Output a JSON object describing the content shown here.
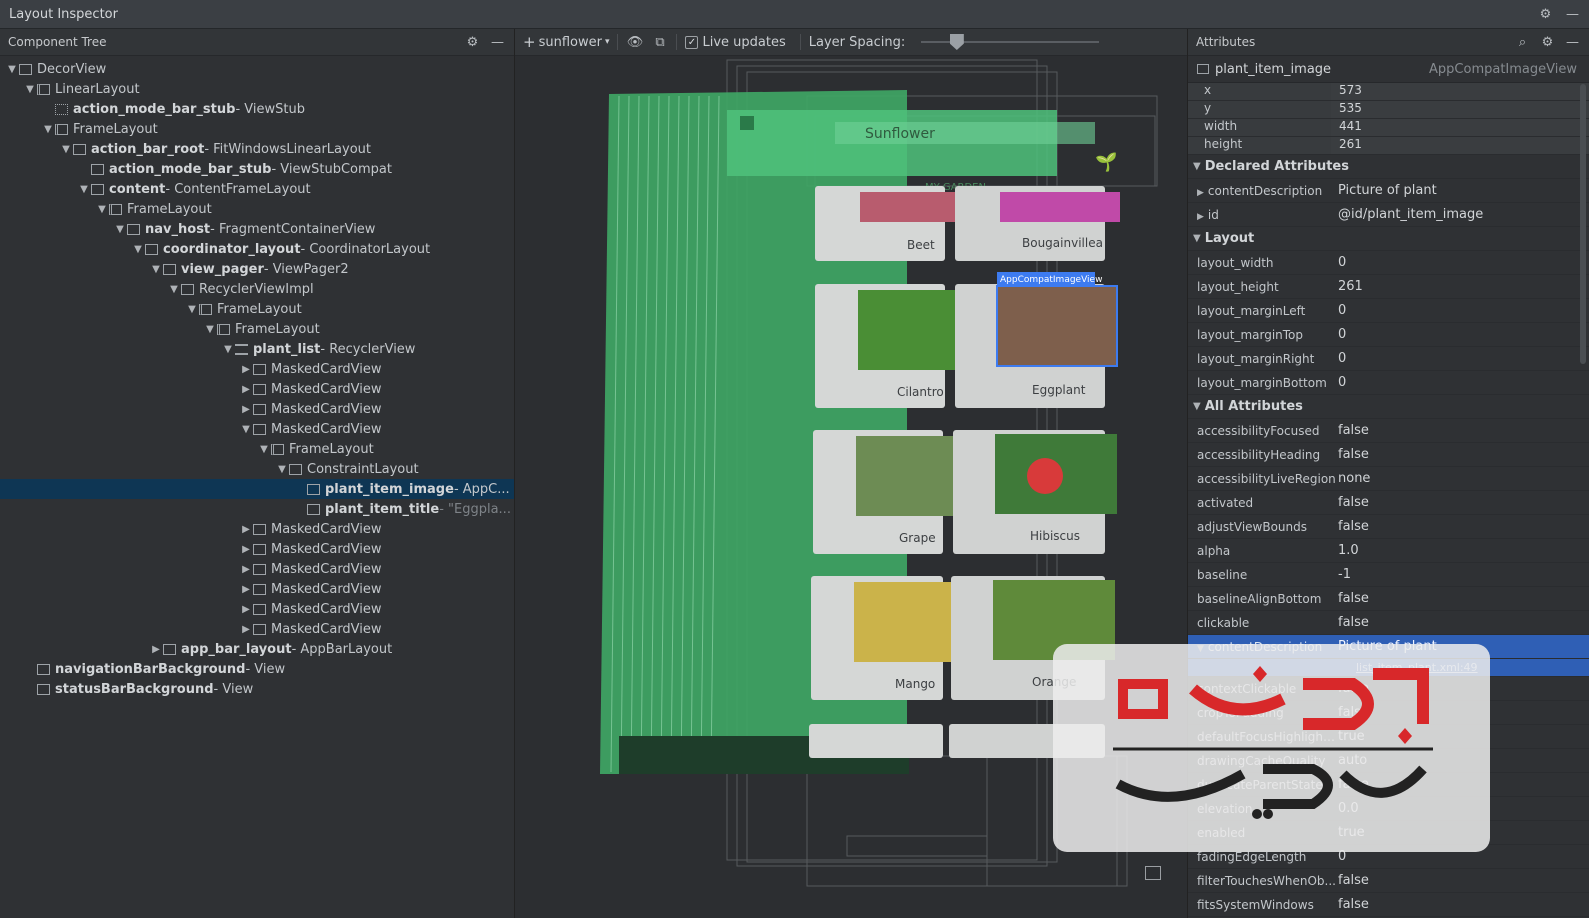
{
  "window": {
    "title": "Layout Inspector"
  },
  "tree_panel": {
    "title": "Component Tree"
  },
  "tree": [
    {
      "arrow": "▼",
      "icon": "window",
      "name": "DecorView",
      "cls": "",
      "bold": false
    },
    {
      "arrow": "▼",
      "icon": "linear",
      "name": "LinearLayout",
      "cls": "",
      "bold": false
    },
    {
      "arrow": "",
      "icon": "stub",
      "name": "action_mode_bar_stub",
      "cls": " - ViewStub",
      "bold": true
    },
    {
      "arrow": "▼",
      "icon": "frame",
      "name": "FrameLayout",
      "cls": "",
      "bold": false
    },
    {
      "arrow": "▼",
      "icon": "window",
      "name": "action_bar_root",
      "cls": " - FitWindowsLinearLayout",
      "bold": true
    },
    {
      "arrow": "",
      "icon": "window",
      "name": "action_mode_bar_stub",
      "cls": " - ViewStubCompat",
      "bold": true
    },
    {
      "arrow": "▼",
      "icon": "window",
      "name": "content",
      "cls": " - ContentFrameLayout",
      "bold": true
    },
    {
      "arrow": "▼",
      "icon": "frame",
      "name": "FrameLayout",
      "cls": "",
      "bold": false
    },
    {
      "arrow": "▼",
      "icon": "window",
      "name": "nav_host",
      "cls": " - FragmentContainerView",
      "bold": true
    },
    {
      "arrow": "▼",
      "icon": "coord",
      "name": "coordinator_layout",
      "cls": " - CoordinatorLayout",
      "bold": true
    },
    {
      "arrow": "▼",
      "icon": "window",
      "name": "view_pager",
      "cls": " - ViewPager2",
      "bold": true
    },
    {
      "arrow": "▼",
      "icon": "window",
      "name": "RecyclerViewImpl",
      "cls": "",
      "bold": false
    },
    {
      "arrow": "▼",
      "icon": "frame",
      "name": "FrameLayout",
      "cls": "",
      "bold": false
    },
    {
      "arrow": "▼",
      "icon": "frame",
      "name": "FrameLayout",
      "cls": "",
      "bold": false
    },
    {
      "arrow": "▼",
      "icon": "list",
      "name": "plant_list",
      "cls": " - RecyclerView",
      "bold": true
    },
    {
      "arrow": "▶",
      "icon": "window",
      "name": "MaskedCardView",
      "cls": "",
      "bold": false
    },
    {
      "arrow": "▶",
      "icon": "window",
      "name": "MaskedCardView",
      "cls": "",
      "bold": false
    },
    {
      "arrow": "▶",
      "icon": "window",
      "name": "MaskedCardView",
      "cls": "",
      "bold": false
    },
    {
      "arrow": "▼",
      "icon": "window",
      "name": "MaskedCardView",
      "cls": "",
      "bold": false
    },
    {
      "arrow": "▼",
      "icon": "frame",
      "name": "FrameLayout",
      "cls": "",
      "bold": false
    },
    {
      "arrow": "▼",
      "icon": "constraint",
      "name": "ConstraintLayout",
      "cls": "",
      "bold": false
    },
    {
      "arrow": "",
      "icon": "window",
      "name": "plant_item_image",
      "cls": " - AppC...",
      "bold": true,
      "selected": true
    },
    {
      "arrow": "",
      "icon": "window",
      "name": "plant_item_title",
      "cls": " - \"Eggpla...",
      "bold": true,
      "grey": true
    },
    {
      "arrow": "▶",
      "icon": "window",
      "name": "MaskedCardView",
      "cls": "",
      "bold": false
    },
    {
      "arrow": "▶",
      "icon": "window",
      "name": "MaskedCardView",
      "cls": "",
      "bold": false
    },
    {
      "arrow": "▶",
      "icon": "window",
      "name": "MaskedCardView",
      "cls": "",
      "bold": false
    },
    {
      "arrow": "▶",
      "icon": "window",
      "name": "MaskedCardView",
      "cls": "",
      "bold": false
    },
    {
      "arrow": "▶",
      "icon": "window",
      "name": "MaskedCardView",
      "cls": "",
      "bold": false
    },
    {
      "arrow": "▶",
      "icon": "window",
      "name": "MaskedCardView",
      "cls": "",
      "bold": false
    },
    {
      "arrow": "▶",
      "icon": "appbar",
      "name": "app_bar_layout",
      "cls": " - AppBarLayout",
      "bold": true
    },
    {
      "arrow": "",
      "icon": "view",
      "name": "navigationBarBackground",
      "cls": " - View",
      "bold": true
    },
    {
      "arrow": "",
      "icon": "view",
      "name": "statusBarBackground",
      "cls": " - View",
      "bold": true
    }
  ],
  "toolbar": {
    "add_label": "sunflower",
    "live_updates_label": "Live updates",
    "live_updates_checked": true,
    "layer_spacing_label": "Layer Spacing:",
    "layer_spacing_level": 0.2
  },
  "preview": {
    "toolbar_title": "Sunflower",
    "tab_label": "MY GARDEN",
    "selected_tag": "AppCompatImageView",
    "plants": [
      "Beet",
      "Bougainvillea",
      "Cilantro",
      "Eggplant",
      "Grape",
      "Hibiscus",
      "Mango",
      "Orange"
    ],
    "colors": {
      "green": "#3fa966",
      "select": "#3d7bf0"
    }
  },
  "attributes": {
    "title": "Attributes",
    "component_name": "plant_item_image",
    "component_type": "AppCompatImageView",
    "geometry": [
      {
        "k": "x",
        "v": "573"
      },
      {
        "k": "y",
        "v": "535"
      },
      {
        "k": "width",
        "v": "441"
      },
      {
        "k": "height",
        "v": "261"
      }
    ],
    "declared_title": "Declared Attributes",
    "declared": [
      {
        "k": "contentDescription",
        "v": "Picture of plant"
      },
      {
        "k": "id",
        "v": "@id/plant_item_image"
      }
    ],
    "layout_title": "Layout",
    "layout": [
      {
        "k": "layout_width",
        "v": "0"
      },
      {
        "k": "layout_height",
        "v": "261"
      },
      {
        "k": "layout_marginLeft",
        "v": "0"
      },
      {
        "k": "layout_marginTop",
        "v": "0"
      },
      {
        "k": "layout_marginRight",
        "v": "0"
      },
      {
        "k": "layout_marginBottom",
        "v": "0"
      }
    ],
    "all_title": "All Attributes",
    "all": [
      {
        "k": "accessibilityFocused",
        "v": "false"
      },
      {
        "k": "accessibilityHeading",
        "v": "false"
      },
      {
        "k": "accessibilityLiveRegion",
        "v": "none"
      },
      {
        "k": "activated",
        "v": "false"
      },
      {
        "k": "adjustViewBounds",
        "v": "false"
      },
      {
        "k": "alpha",
        "v": "1.0"
      },
      {
        "k": "baseline",
        "v": "-1"
      },
      {
        "k": "baselineAlignBottom",
        "v": "false"
      },
      {
        "k": "clickable",
        "v": "false"
      },
      {
        "k": "contentDescription",
        "v": "Picture of plant",
        "highlight": true,
        "source": "list_item_plant.xml:49"
      },
      {
        "k": "contextClickable",
        "v": "false"
      },
      {
        "k": "cropToPadding",
        "v": "false"
      },
      {
        "k": "defaultFocusHighlight...",
        "v": "true"
      },
      {
        "k": "drawingCacheQuality",
        "v": "auto"
      },
      {
        "k": "duplicateParentState",
        "v": "false"
      },
      {
        "k": "elevation",
        "v": "0.0"
      },
      {
        "k": "enabled",
        "v": "true"
      },
      {
        "k": "fadingEdgeLength",
        "v": "0"
      },
      {
        "k": "filterTouchesWhenOb...",
        "v": "false"
      },
      {
        "k": "fitsSystemWindows",
        "v": "false"
      }
    ]
  },
  "watermark_text": "برنامه نویسان"
}
